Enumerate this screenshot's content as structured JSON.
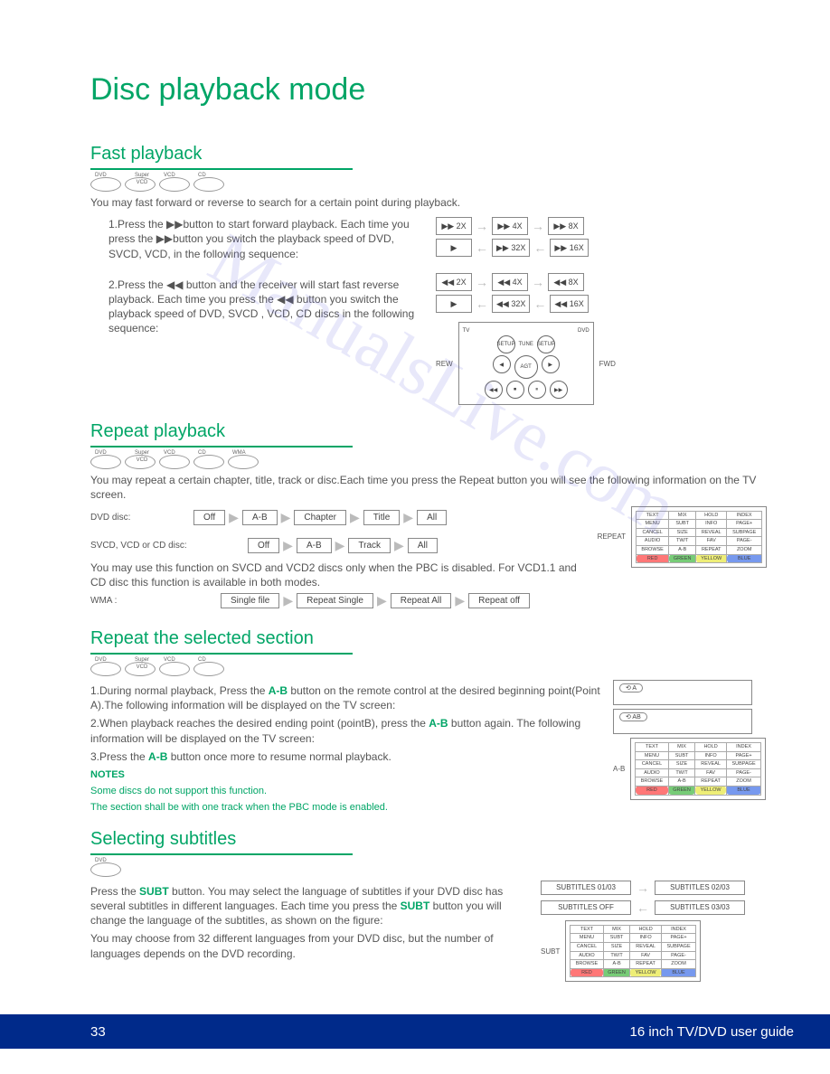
{
  "page_title": "Disc playback mode",
  "footer": {
    "page_num": "33",
    "guide": "16 inch TV/DVD user guide"
  },
  "watermark": "ManualsLive.com",
  "fast": {
    "title": "Fast playback",
    "discs": [
      "DVD",
      "Super VCD",
      "VCD",
      "CD"
    ],
    "intro": "You may fast forward or reverse to search for a certain point during playback.",
    "step1_a": "1.Press the ",
    "step1_b": "button to start forward playback. Each time you press the ",
    "step1_c": "button you switch the playback speed of DVD, SVCD, VCD,  in the following sequence:",
    "step2_a": "2.Press the ",
    "step2_b": " button and the receiver will start fast reverse playback. Each time you press the ",
    "step2_c": " button you switch the playback speed of DVD, SVCD , VCD, CD discs in the following sequence:",
    "forward_seq_top": [
      "▶▶ 2X",
      "▶▶ 4X",
      "▶▶ 8X"
    ],
    "forward_seq_bot": [
      "▶",
      "▶▶ 32X",
      "▶▶ 16X"
    ],
    "reverse_seq_top": [
      "◀◀ 2X",
      "◀◀ 4X",
      "◀◀ 8X"
    ],
    "reverse_seq_bot": [
      "▶",
      "◀◀ 32X",
      "◀◀ 16X"
    ],
    "remote_top_labels": {
      "left": "TV",
      "right": "DVD",
      "center": "TUNE"
    },
    "remote_side_labels": {
      "left": "REW",
      "right": "FWD"
    },
    "remote_buttons": {
      "setup_l": "SETUP",
      "setup_r": "SETUP",
      "center": "AGT"
    }
  },
  "repeat": {
    "title": "Repeat playback",
    "discs": [
      "DVD",
      "Super VCD",
      "VCD",
      "CD",
      "WMA"
    ],
    "intro": "You may repeat a certain chapter, title, track or disc.Each time you press the Repeat button you will see the following information on the TV screen.",
    "dvd_label": "DVD disc:",
    "dvd_seq": [
      "Off",
      "A-B",
      "Chapter",
      "Title",
      "All"
    ],
    "svcd_label": "SVCD, VCD or CD disc:",
    "svcd_seq": [
      "Off",
      "A-B",
      "Track",
      "All"
    ],
    "note": "You may use this function on SVCD and VCD2 discs only when the PBC is disabled. For VCD1.1 and CD disc this function is available in both modes.",
    "wma_label": "WMA :",
    "wma_seq": [
      "Single file",
      "Repeat Single",
      "Repeat All",
      "Repeat off"
    ],
    "remote_label": "REPEAT",
    "remote_grid": [
      [
        "TEXT",
        "MIX",
        "HOLD",
        "INDEX"
      ],
      [
        "MENU",
        "SUBT",
        "INFO",
        "PAGE+"
      ],
      [
        "CANCEL",
        "SIZE",
        "REVEAL",
        "SUBPAGE"
      ],
      [
        "AUDIO",
        "TW/T",
        "FAV",
        "PAGE-"
      ],
      [
        "BROWSE",
        "A-B",
        "REPEAT",
        "ZOOM"
      ],
      [
        "RED",
        "GREEN",
        "YELLOW",
        "BLUE"
      ]
    ]
  },
  "ab": {
    "title": "Repeat the selected section",
    "discs": [
      "DVD",
      "Super VCD",
      "VCD",
      "CD"
    ],
    "step1_a": "1.During normal playback, Press the ",
    "step1_btn": "A-B",
    "step1_b": " button on the remote control at the desired beginning point(Point A).The following information will be displayed on the TV screen:",
    "step2_a": "2.When playback reaches the desired ending point (pointB), press the ",
    "step2_btn": "A-B",
    "step2_b": " button again. The following information will be displayed on the TV screen:",
    "step3_a": "3.Press the ",
    "step3_btn": "A-B",
    "step3_b": " button once more to resume normal playback.",
    "notes_title": "NOTES",
    "note1": "Some discs  do not support this function.",
    "note2": "The section shall be with one track when the PBC mode is enabled.",
    "screen1": "⟲ A",
    "screen2": "⟲ AB",
    "remote_label": "A-B"
  },
  "subtitles": {
    "title": "Selecting subtitles",
    "discs": [
      "DVD"
    ],
    "p1_a": "Press the ",
    "p1_btn": "SUBT",
    "p1_b": " button. You may select the language of subtitles if your DVD disc has several subtitles in different languages. Each time you press the ",
    "p1_btn2": "SUBT",
    "p1_c": " button you will change the language of the subtitles, as shown on the figure:",
    "p2": "You may choose from 32 different languages from your DVD disc, but the number of languages depends on the DVD recording.",
    "seq": [
      "SUBTITLES 01/03",
      "SUBTITLES 02/03",
      "SUBTITLES OFF",
      "SUBTITLES 03/03"
    ],
    "remote_label": "SUBT"
  }
}
